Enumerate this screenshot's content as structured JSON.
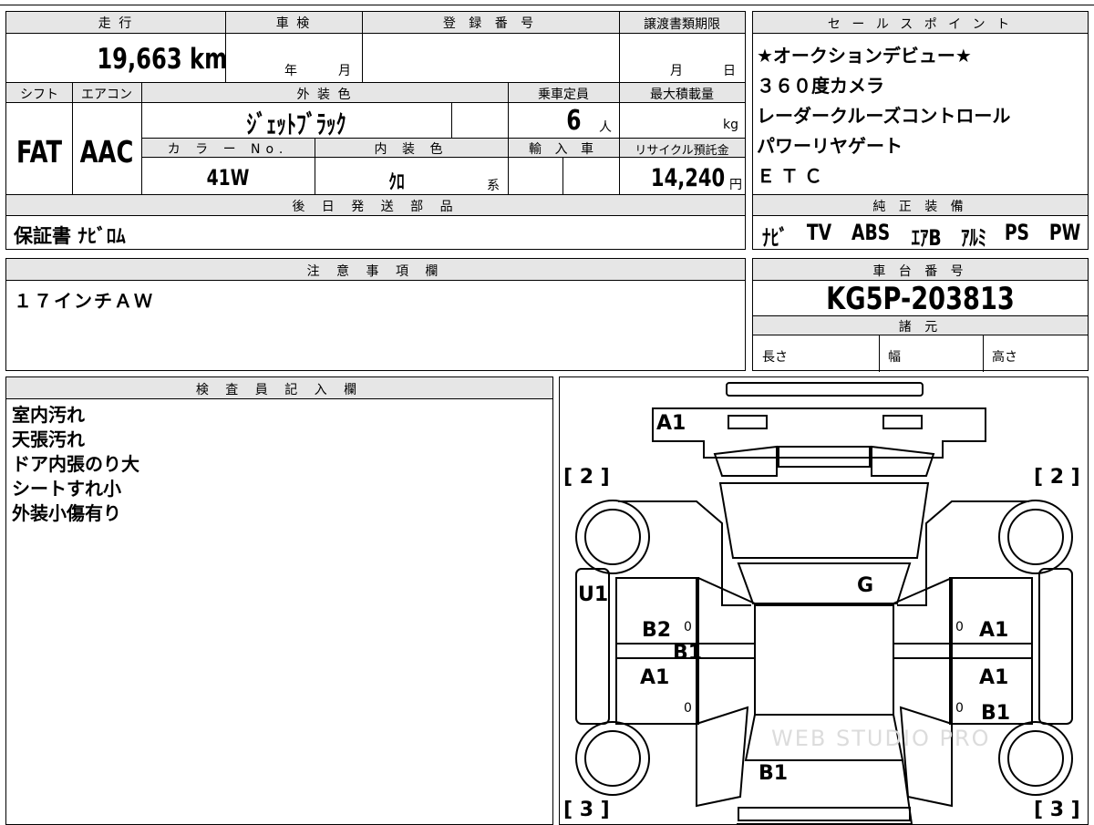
{
  "left_panel": {
    "headers": {
      "mileage": "走 行",
      "inspection": "車 検",
      "registration_number": "登 録 番 号",
      "transfer_docs": "譲渡書類期限",
      "shift": "シフト",
      "aircon": "エアコン",
      "exterior_color": "外 装 色",
      "capacity": "乗車定員",
      "max_load": "最大積載量",
      "color_no": "カ ラ ー No.",
      "interior_color": "内 装 色",
      "import": "輸 入 車",
      "recycle": "リサイクル預託金",
      "later_parts": "後 日 発 送 部 品",
      "notes": "注 意 事 項 欄",
      "inspector": "検 査 員 記 入 欄"
    },
    "values": {
      "mileage": "19,663 km",
      "inspection_year_unit": "年",
      "inspection_month_unit": "月",
      "transfer_month_unit": "月",
      "transfer_day_unit": "日",
      "shift": "FAT",
      "aircon": "AAC",
      "exterior_color": "ｼﾞｪｯﾄﾌﾞﾗｯｸ",
      "capacity": "6",
      "capacity_unit": "人",
      "max_load_unit": "kg",
      "color_no": "41W",
      "interior_color": "ｸﾛ",
      "interior_suffix": "系",
      "recycle_fee": "14,240",
      "recycle_unit": "円",
      "later_parts": "保証書 ﾅﾋﾞﾛﾑ",
      "notes": "１７インチＡＷ"
    },
    "inspector_lines": [
      "室内汚れ",
      "天張汚れ",
      "ドア内張のり大",
      "シートすれ小",
      "外装小傷有り"
    ]
  },
  "right_panel": {
    "sales_points_header": "セ ー ル ス ポ イ ン ト",
    "sales_points": [
      "★オークションデビュー★",
      "３６０度カメラ",
      "レーダークルーズコントロール",
      "パワーリヤゲート",
      "ＥＴＣ"
    ],
    "equipment_header": "純 正 装 備",
    "equipment": [
      "ﾅﾋﾞ",
      "TV",
      "ABS",
      "ｴｱB",
      "ｱﾙﾐ",
      "PS",
      "PW"
    ],
    "chassis_header": "車 台 番 号",
    "chassis_number": "KG5P-203813",
    "specs_header": "諸 元",
    "specs": {
      "length": "長さ",
      "width": "幅",
      "height": "高さ"
    }
  },
  "diagram": {
    "labels": {
      "front": "A1",
      "left_front_tire": "[ 2 ]",
      "right_front_tire": "[ 2 ]",
      "left_rear_tire": "[ 3 ]",
      "right_rear_tire": "[ 3 ]",
      "left_side": "U1",
      "hood_roof": "G",
      "left_front_door_top": "B2",
      "left_front_door_mid": "B1",
      "left_rear_door": "A1",
      "right_front_door": "A1",
      "right_rear_door_top": "A1",
      "right_rear_door_bottom": "B1",
      "rear": "B1",
      "zero": "0"
    },
    "watermark": "WEB STUDIO PRO"
  }
}
